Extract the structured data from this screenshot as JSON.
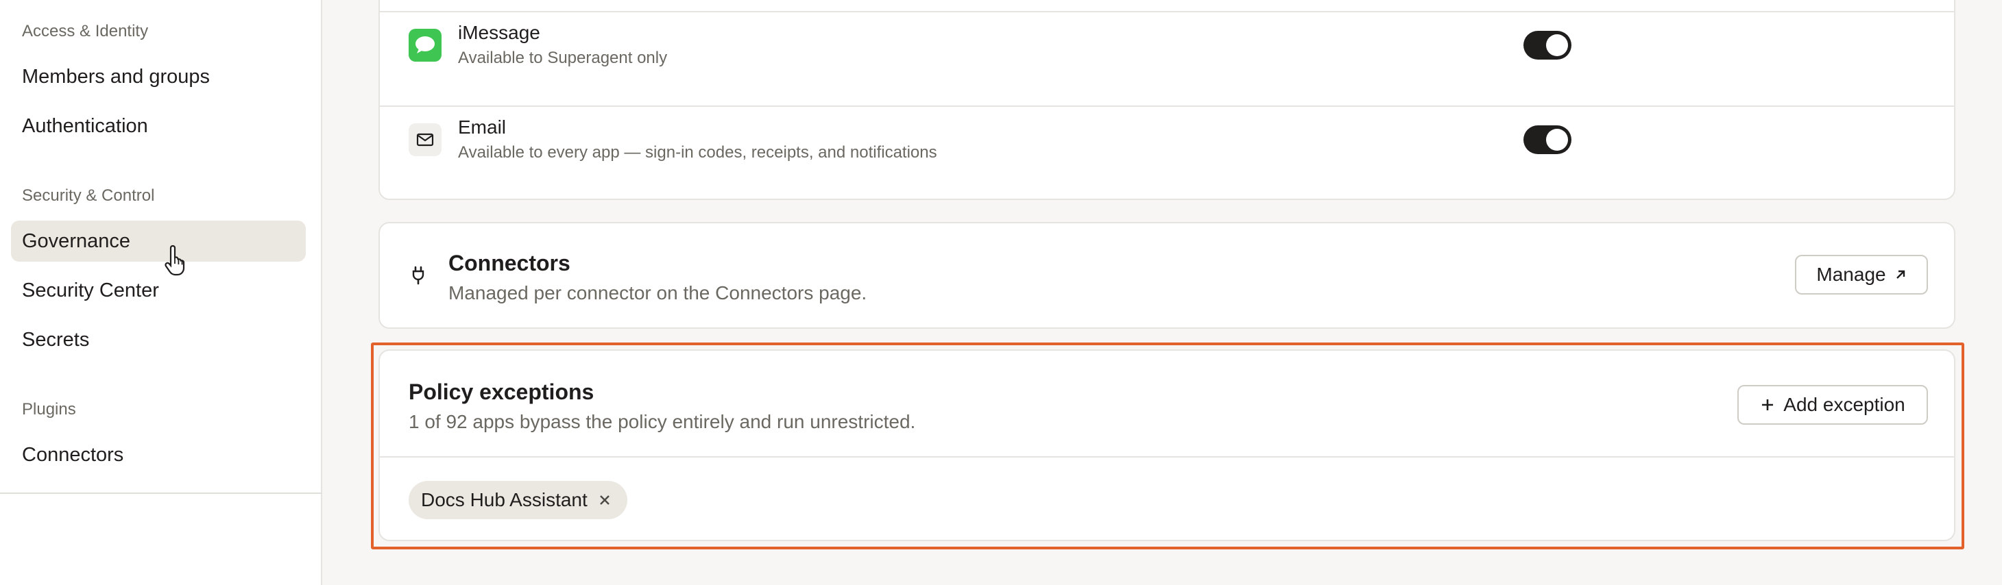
{
  "sidebar": {
    "sections": [
      {
        "label": "Access & Identity",
        "items": [
          "Members and groups",
          "Authentication"
        ]
      },
      {
        "label": "Security & Control",
        "items": [
          "Governance",
          "Security Center",
          "Secrets"
        ]
      },
      {
        "label": "Plugins",
        "items": [
          "Connectors"
        ]
      }
    ],
    "active_item": "Governance"
  },
  "channels": [
    {
      "name": "iMessage",
      "description": "Available to Superagent only",
      "enabled": true,
      "icon": "imessage-icon"
    },
    {
      "name": "Email",
      "description": "Available to every app — sign-in codes, receipts, and notifications",
      "enabled": true,
      "icon": "mail-icon"
    }
  ],
  "connectors": {
    "title": "Connectors",
    "description": "Managed per connector on the Connectors page.",
    "manage_label": "Manage",
    "manage_icon": "external-arrow-icon",
    "icon": "plug-icon"
  },
  "policy_exceptions": {
    "title": "Policy exceptions",
    "description": "1 of 92 apps bypass the policy entirely and run unrestricted.",
    "add_label": "Add exception",
    "add_icon": "plus-icon",
    "exceptions": [
      {
        "label": "Docs Hub Assistant",
        "remove_icon": "close-icon"
      }
    ]
  },
  "colors": {
    "accent_highlight": "#e3622b",
    "imessage_green": "#3fc552",
    "toggle_on": "#1f1e1c",
    "active_nav_bg": "#ebe8e2"
  }
}
